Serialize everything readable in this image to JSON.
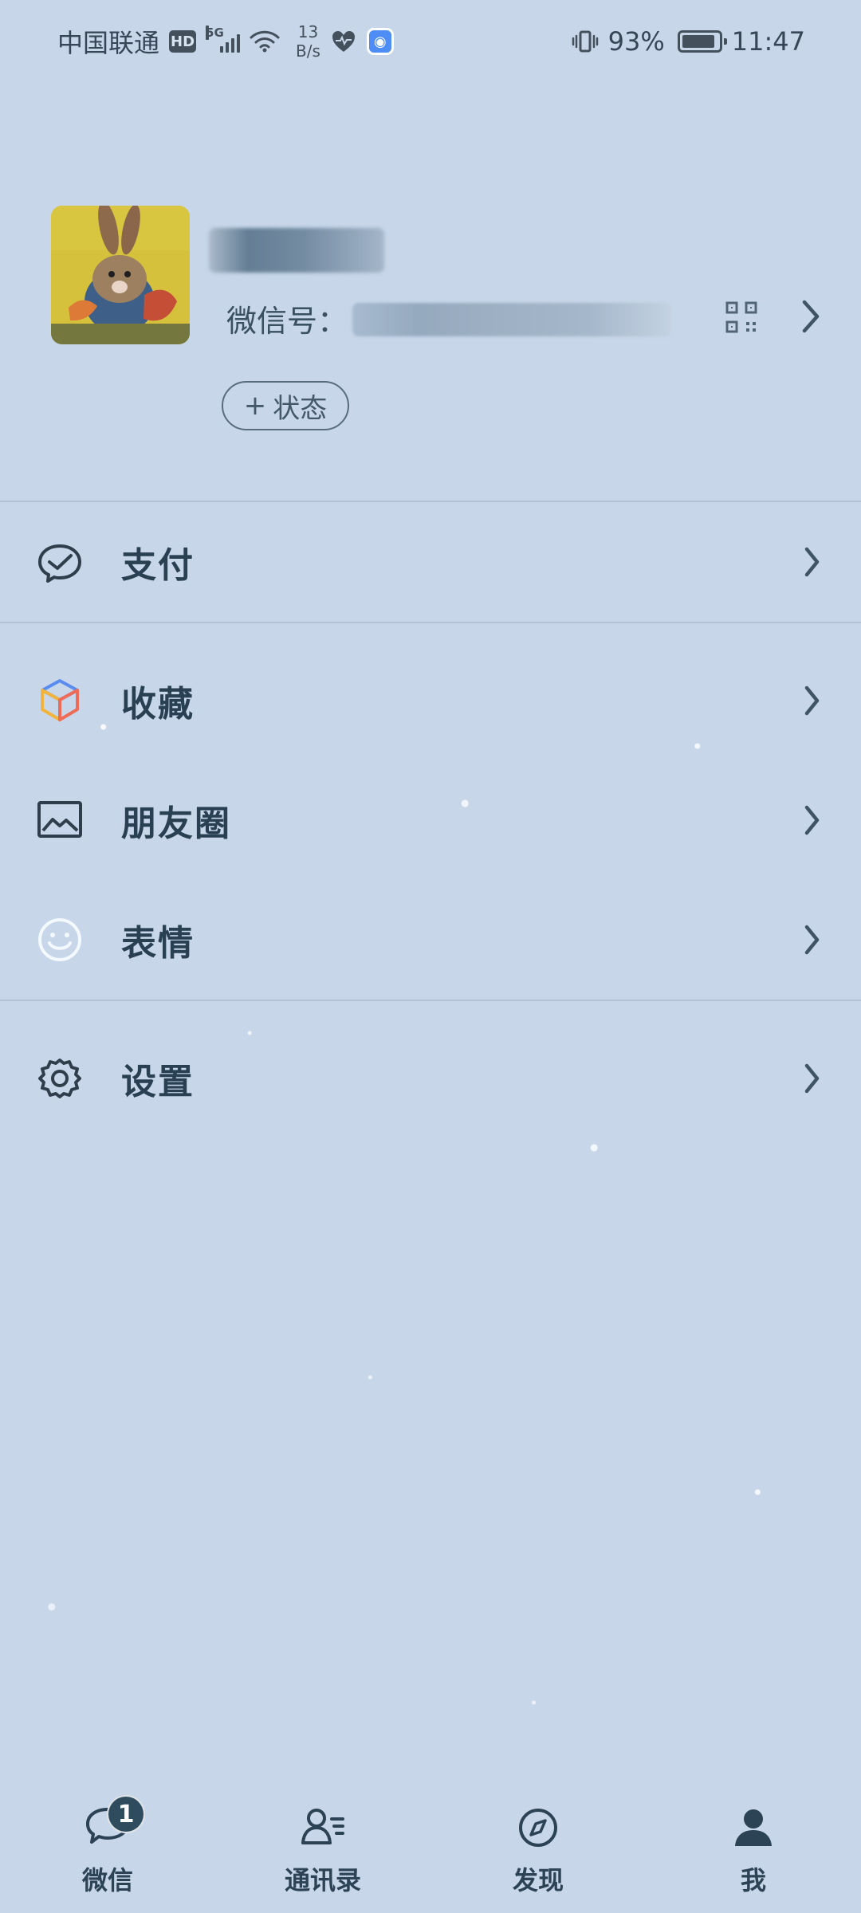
{
  "status_bar": {
    "carrier": "中国联通",
    "network_badge": "HD",
    "network_type": "5G",
    "speed_value": "13",
    "speed_unit": "B/s",
    "battery_percent": "93%",
    "battery_level": 0.93,
    "time": "11:47",
    "icons": [
      "sim-signal-icon",
      "wifi-icon",
      "health-icon",
      "browser-icon",
      "vibrate-icon",
      "battery-icon"
    ]
  },
  "profile": {
    "wechat_id_label": "微信号：",
    "status_button": "状态",
    "status_button_symbol": "+",
    "chevron_icon": "chevron-right-icon",
    "qr_icon": "qrcode-icon"
  },
  "menu": {
    "items": [
      {
        "label": "支付",
        "icon": "pay-icon"
      },
      {
        "label": "收藏",
        "icon": "favorites-icon"
      },
      {
        "label": "朋友圈",
        "icon": "moments-icon"
      },
      {
        "label": "表情",
        "icon": "sticker-icon"
      },
      {
        "label": "设置",
        "icon": "settings-icon"
      }
    ]
  },
  "bottom_nav": {
    "items": [
      {
        "label": "微信",
        "badge": "1",
        "icon": "chat-icon"
      },
      {
        "label": "通讯录",
        "icon": "contacts-icon"
      },
      {
        "label": "发现",
        "icon": "discover-icon"
      },
      {
        "label": "我",
        "icon": "me-icon"
      }
    ]
  },
  "colors": {
    "background": "#c7d6e9",
    "primary_text": "#2a3f4f",
    "secondary_text": "#43596a",
    "badge_background": "#2f4c5f"
  }
}
